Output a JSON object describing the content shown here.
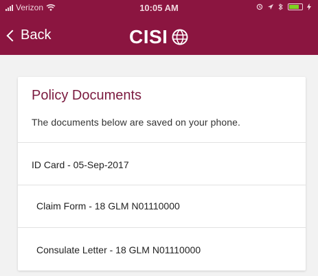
{
  "status_bar": {
    "carrier": "Verizon",
    "time": "10:05 AM"
  },
  "header": {
    "back_label": "Back",
    "logo_text": "CISI",
    "brand_color": "#8b1540"
  },
  "card": {
    "title": "Policy Documents",
    "subtitle": "The documents below are saved on your phone.",
    "documents": [
      {
        "label": "ID Card - 05-Sep-2017"
      },
      {
        "label": "Claim Form - 18 GLM N01110000"
      },
      {
        "label": "Consulate Letter - 18 GLM N01110000"
      }
    ]
  }
}
